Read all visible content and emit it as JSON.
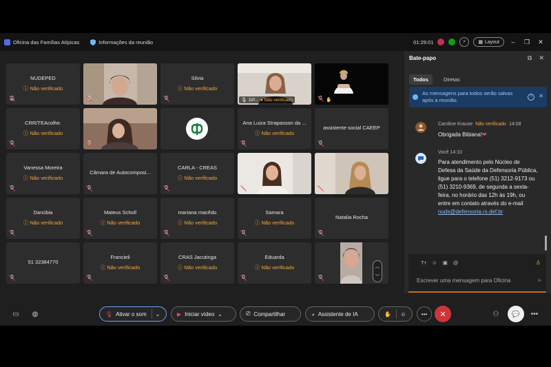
{
  "window": {
    "app_name": "Oficina das Famílias Atípicas",
    "meeting_info": "Informações da reunião",
    "timer": "01:29:01",
    "layout_label": "Layout"
  },
  "participants": [
    {
      "name": "NUDEPED",
      "status": "Não verificado"
    },
    {
      "name": "",
      "status": ""
    },
    {
      "name": "Silvia",
      "status": "Não verificado"
    },
    {
      "name": "DP...",
      "status": "Não verificado"
    },
    {
      "name": "",
      "status": ""
    },
    {
      "name": "CRR/TEAcolhe.",
      "status": "Não verificado"
    },
    {
      "name": "",
      "status": ""
    },
    {
      "name": "",
      "status": ""
    },
    {
      "name": "Ana Luiza Strapasson da ...",
      "status": "Não verificado"
    },
    {
      "name": "assistente social CAEEP",
      "status": ""
    },
    {
      "name": "Vanessa Moreira",
      "status": "Não verificado"
    },
    {
      "name": "Câmara de Autocomposi...",
      "status": ""
    },
    {
      "name": "CARLA - CREAS",
      "status": "Não verificado"
    },
    {
      "name": "",
      "status": ""
    },
    {
      "name": "",
      "status": ""
    },
    {
      "name": "Danúbia",
      "status": "Não verificado"
    },
    {
      "name": "Mateus Scholl",
      "status": "Não verificado"
    },
    {
      "name": "mariana macêdo",
      "status": "Não verificado"
    },
    {
      "name": "Samara",
      "status": "Não verificado"
    },
    {
      "name": "Natalia Rocha",
      "status": ""
    },
    {
      "name": "51 32384770",
      "status": ""
    },
    {
      "name": "Francieli",
      "status": "Não verificado"
    },
    {
      "name": "CRAS Jacutinga",
      "status": "Não verificado"
    },
    {
      "name": "Eduarda",
      "status": "Não verificado"
    },
    {
      "name": "",
      "status": ""
    }
  ],
  "chat": {
    "title": "Bate-papo",
    "tabs": [
      "Todos",
      "Diretas"
    ],
    "banner": "As mensagens para todos serão salvas após a reunião.",
    "messages": [
      {
        "author": "Caroline Krause",
        "badge": "Não verificado",
        "time": "14:08",
        "text": "Obrigada Bibiana!",
        "emoji": "❤"
      },
      {
        "author": "Você",
        "time": "14:10",
        "text": "Para atendimento pelo Núcleo de Defesa da Saúde da Defensoria Pública, ligue para o telefone (51) 3212-9173 ou (51) 3210-9369, de segunda a sexta-feira, no horário das 12h às 19h, ou entre em contato através do e-mail",
        "link": "nuds@defensoria.rs.def.br"
      }
    ],
    "compose_placeholder": "Escrever uma mensagem para Oficina"
  },
  "toolbar": {
    "mute_label": "Ativar o som",
    "video_label": "Iniciar vídeo",
    "share_label": "Compartilhar",
    "ai_label": "Assistente de IA"
  },
  "colors": {
    "unverified": "#f2a93b",
    "hangup": "#d13438",
    "active_border": "#4db8a8"
  }
}
